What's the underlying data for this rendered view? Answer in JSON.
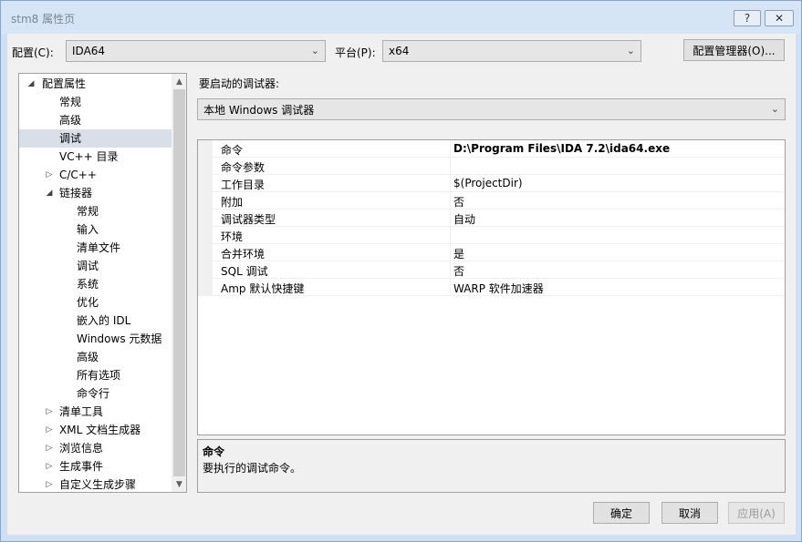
{
  "window": {
    "title": "stm8 属性页",
    "help_glyph": "?",
    "close_glyph": "✕"
  },
  "toolbar": {
    "config_label": "配置(C):",
    "config_value": "IDA64",
    "platform_label": "平台(P):",
    "platform_value": "x64",
    "config_manager_label": "配置管理器(O)..."
  },
  "icons": {
    "chevron_down": "chevron-down-icon",
    "expanded": "triangle-expanded-icon",
    "collapsed": "triangle-collapsed-icon"
  },
  "tree": {
    "root": "配置属性",
    "items": [
      {
        "label": "常规"
      },
      {
        "label": "高级"
      },
      {
        "label": "调试"
      },
      {
        "label": "VC++ 目录"
      },
      {
        "label": "C/C++"
      },
      {
        "label": "链接器"
      },
      {
        "label": "常规"
      },
      {
        "label": "输入"
      },
      {
        "label": "清单文件"
      },
      {
        "label": "调试"
      },
      {
        "label": "系统"
      },
      {
        "label": "优化"
      },
      {
        "label": "嵌入的 IDL"
      },
      {
        "label": "Windows 元数据"
      },
      {
        "label": "高级"
      },
      {
        "label": "所有选项"
      },
      {
        "label": "命令行"
      },
      {
        "label": "清单工具"
      },
      {
        "label": "XML 文档生成器"
      },
      {
        "label": "浏览信息"
      },
      {
        "label": "生成事件"
      },
      {
        "label": "自定义生成步骤"
      }
    ]
  },
  "debugger": {
    "label": "要启动的调试器:",
    "value": "本地 Windows 调试器"
  },
  "properties": [
    {
      "name": "命令",
      "value": "D:\\Program Files\\IDA 7.2\\ida64.exe"
    },
    {
      "name": "命令参数",
      "value": ""
    },
    {
      "name": "工作目录",
      "value": "$(ProjectDir)"
    },
    {
      "name": "附加",
      "value": "否"
    },
    {
      "name": "调试器类型",
      "value": "自动"
    },
    {
      "name": "环境",
      "value": ""
    },
    {
      "name": "合并环境",
      "value": "是"
    },
    {
      "name": "SQL 调试",
      "value": "否"
    },
    {
      "name": "Amp 默认快捷键",
      "value": "WARP 软件加速器"
    }
  ],
  "description": {
    "title": "命令",
    "text": "要执行的调试命令。"
  },
  "buttons": {
    "ok": "确定",
    "cancel": "取消",
    "apply": "应用(A)"
  }
}
